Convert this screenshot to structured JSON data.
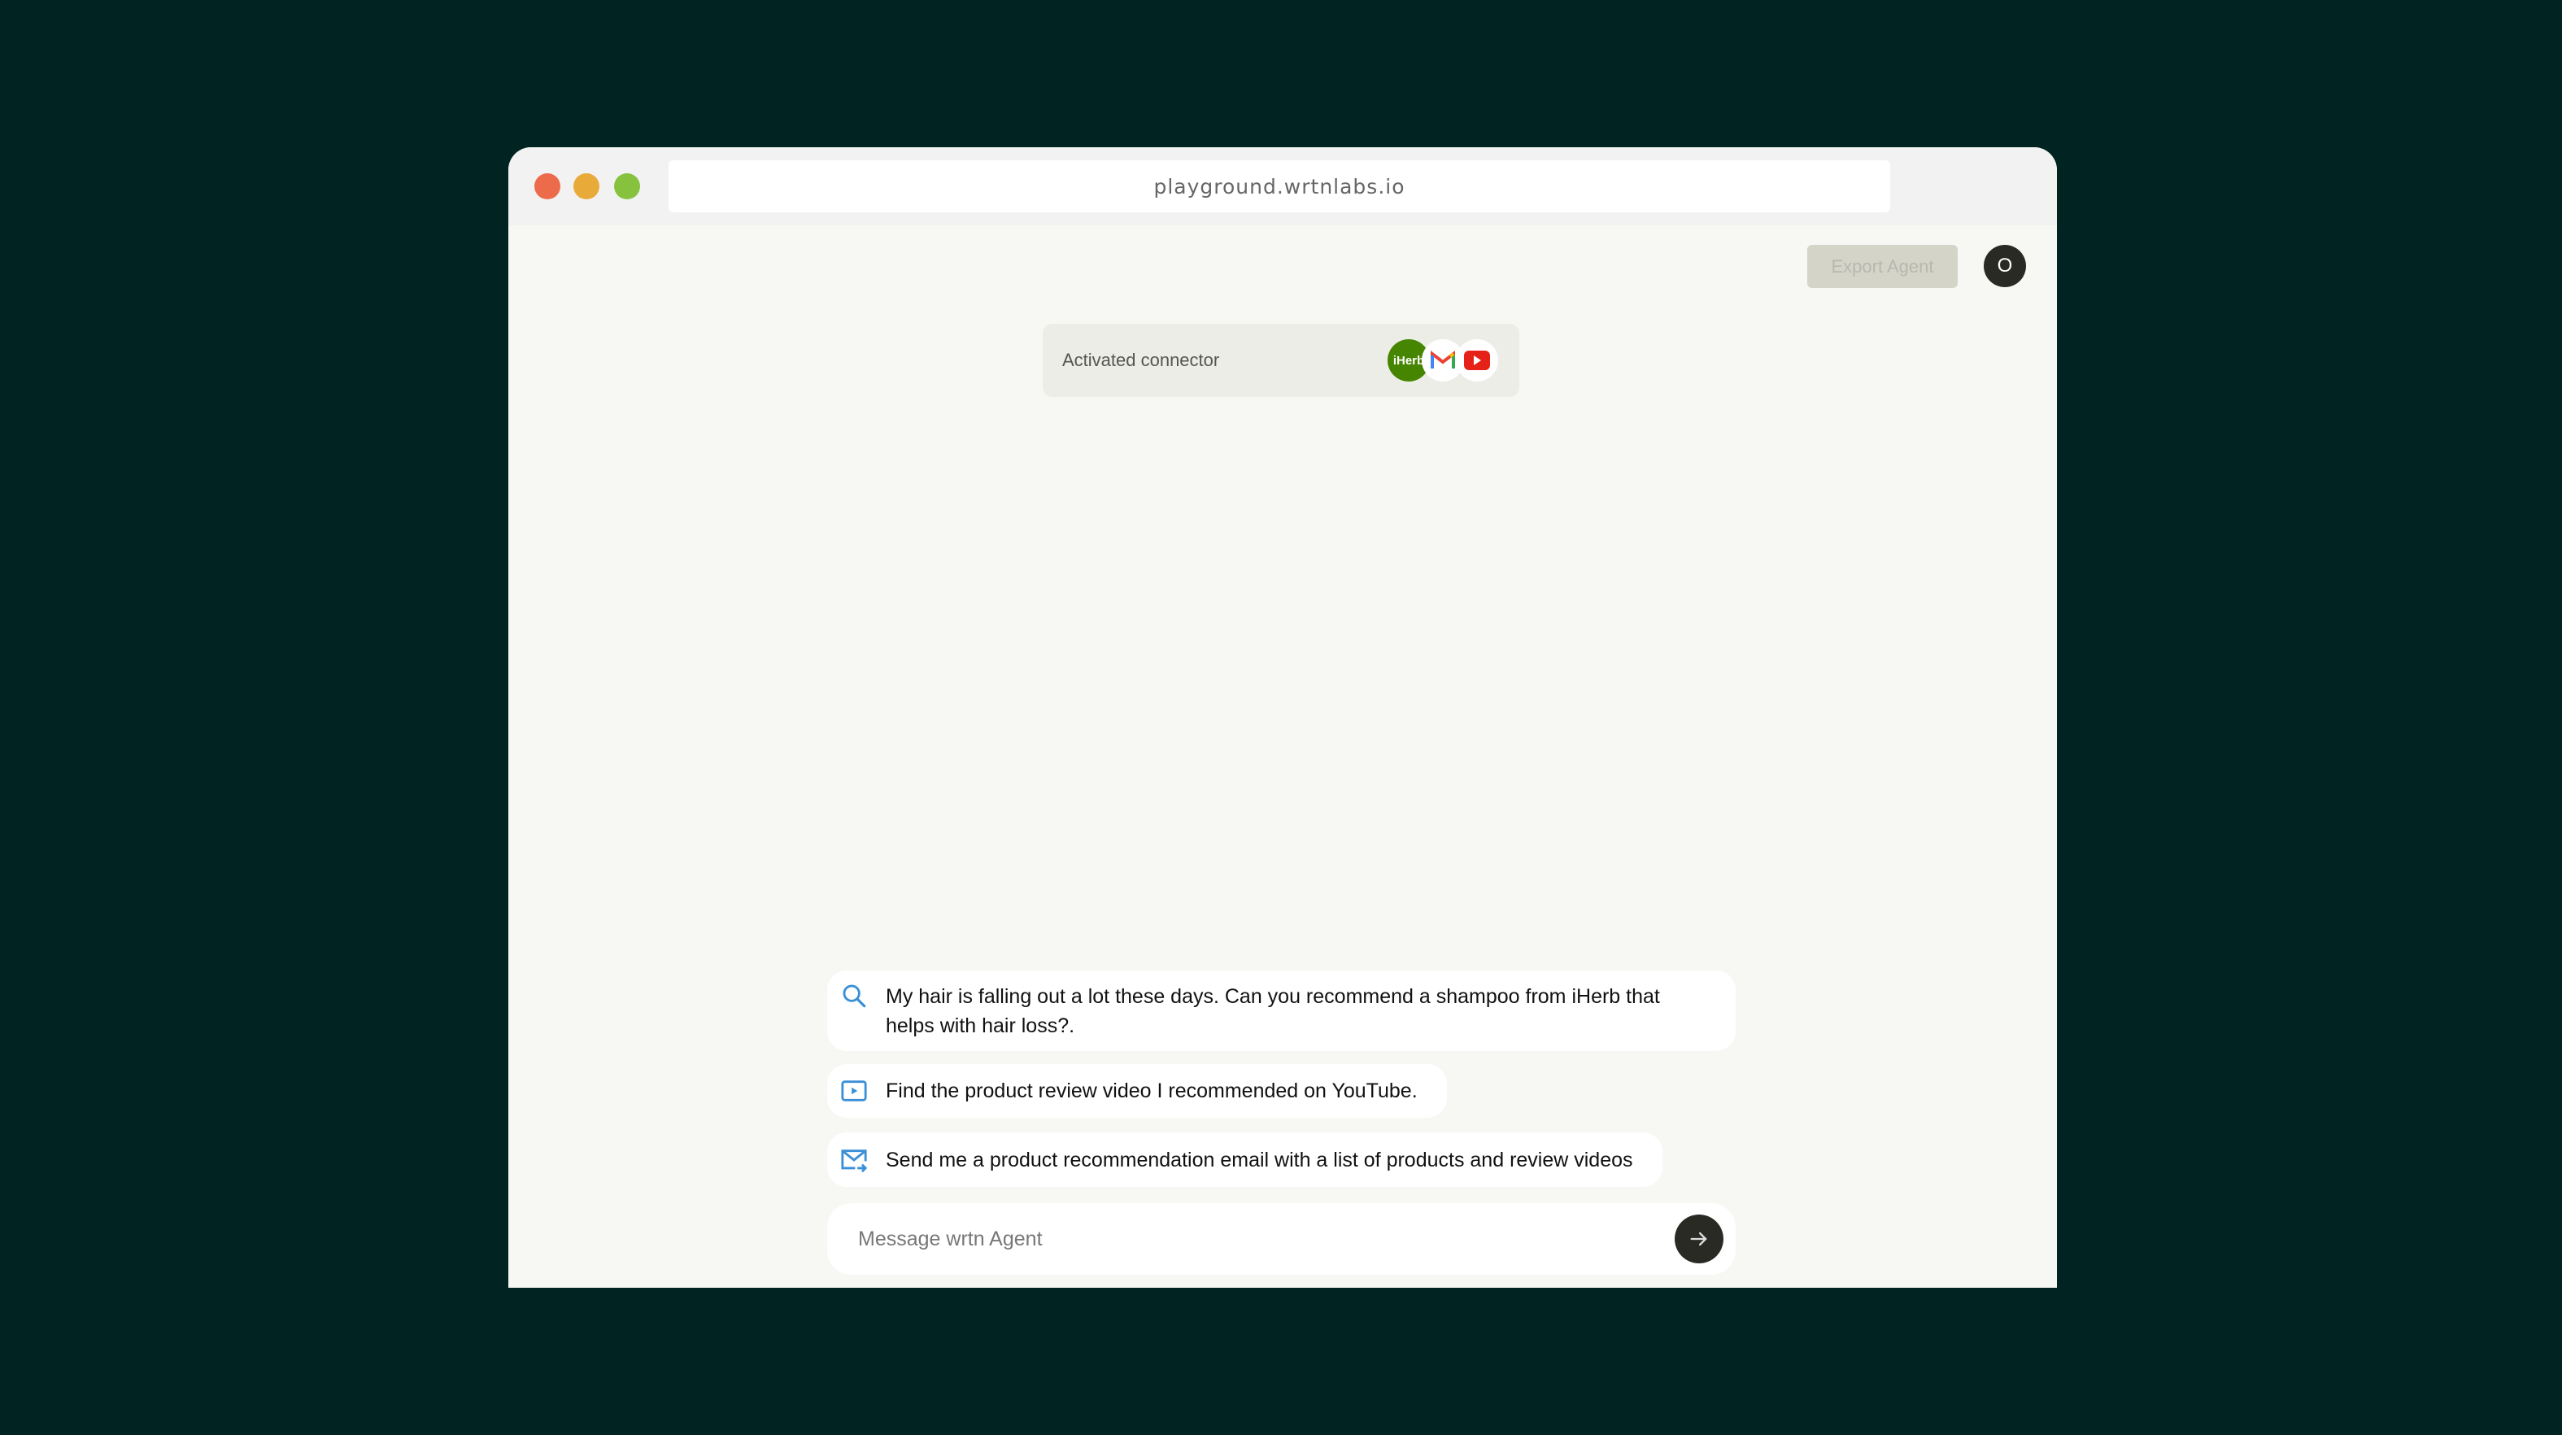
{
  "browser": {
    "url": "playground.wrtnlabs.io",
    "dots": {
      "close": "#ec6b4a",
      "minimize": "#e8aa38",
      "maximize": "#86c23e"
    }
  },
  "header": {
    "export_label": "Export Agent",
    "avatar_initial": "O"
  },
  "connectors": {
    "label": "Activated connector",
    "items": [
      {
        "name": "iHerb",
        "color": "#458500"
      },
      {
        "name": "gmail-icon"
      },
      {
        "name": "youtube-icon",
        "color": "#e62117"
      }
    ]
  },
  "suggestions": [
    {
      "icon": "search-icon",
      "text": "My hair is falling out a lot these days. Can you recommend a shampoo from iHerb that helps with hair loss?."
    },
    {
      "icon": "video-icon",
      "text": "Find the product review video I recommended on YouTube."
    },
    {
      "icon": "mail-send-icon",
      "text": "Send me a product recommendation email with a list of products and review videos"
    }
  ],
  "composer": {
    "placeholder": "Message wrtn Agent",
    "value": ""
  },
  "accent": "#3a8fd6"
}
